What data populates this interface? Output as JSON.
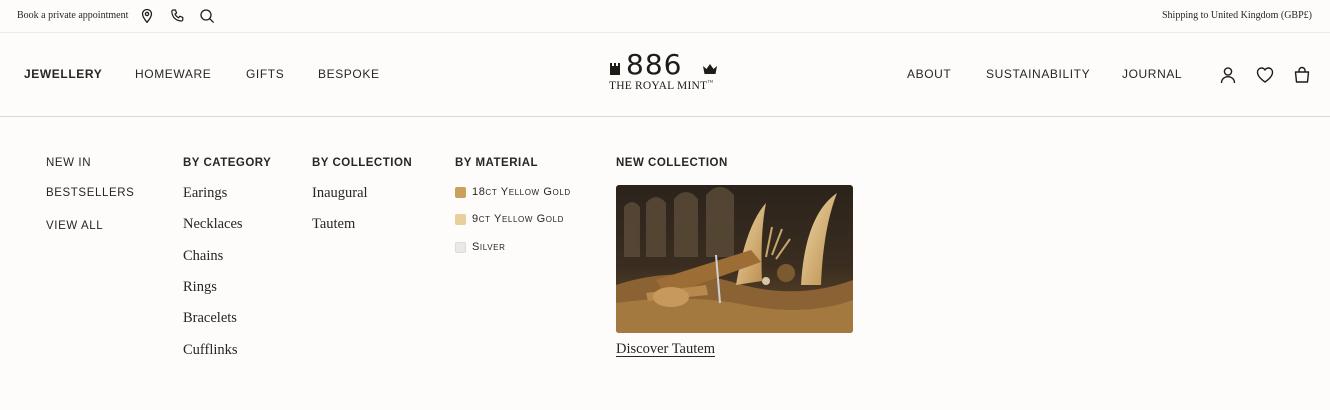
{
  "topbar": {
    "appointment_label": "Book a private appointment",
    "shipping_label": "Shipping to United Kingdom (GBP£)"
  },
  "header": {
    "nav_left": [
      "JEWELLERY",
      "HOMEWARE",
      "GIFTS",
      "BESPOKE"
    ],
    "nav_right": [
      "ABOUT",
      "SUSTAINABILITY",
      "JOURNAL"
    ],
    "logo_number": "886",
    "logo_subtitle": "THE ROYAL MINT",
    "logo_tm": "™"
  },
  "menu": {
    "quick_links": [
      "NEW IN",
      "BESTSELLERS",
      "VIEW ALL"
    ],
    "by_category": {
      "heading": "BY CATEGORY",
      "items": [
        "Earings",
        "Necklaces",
        "Chains",
        "Rings",
        "Bracelets",
        "Cufflinks"
      ]
    },
    "by_collection": {
      "heading": "BY COLLECTION",
      "items": [
        "Inaugural",
        "Tautem"
      ]
    },
    "by_material": {
      "heading": "BY MATERIAL",
      "items": [
        {
          "label": "18ct Yellow Gold",
          "color": "#c9a15c"
        },
        {
          "label": "9ct Yellow Gold",
          "color": "#e8cf9c"
        },
        {
          "label": "Silver",
          "color": "#ebe9e6"
        }
      ]
    },
    "new_collection": {
      "heading": "NEW COLLECTION",
      "link_label": "Discover Tautem"
    }
  },
  "colors": {
    "background": "#fdfcfa",
    "text": "#2a2520",
    "divider": "#dcd8d2"
  }
}
